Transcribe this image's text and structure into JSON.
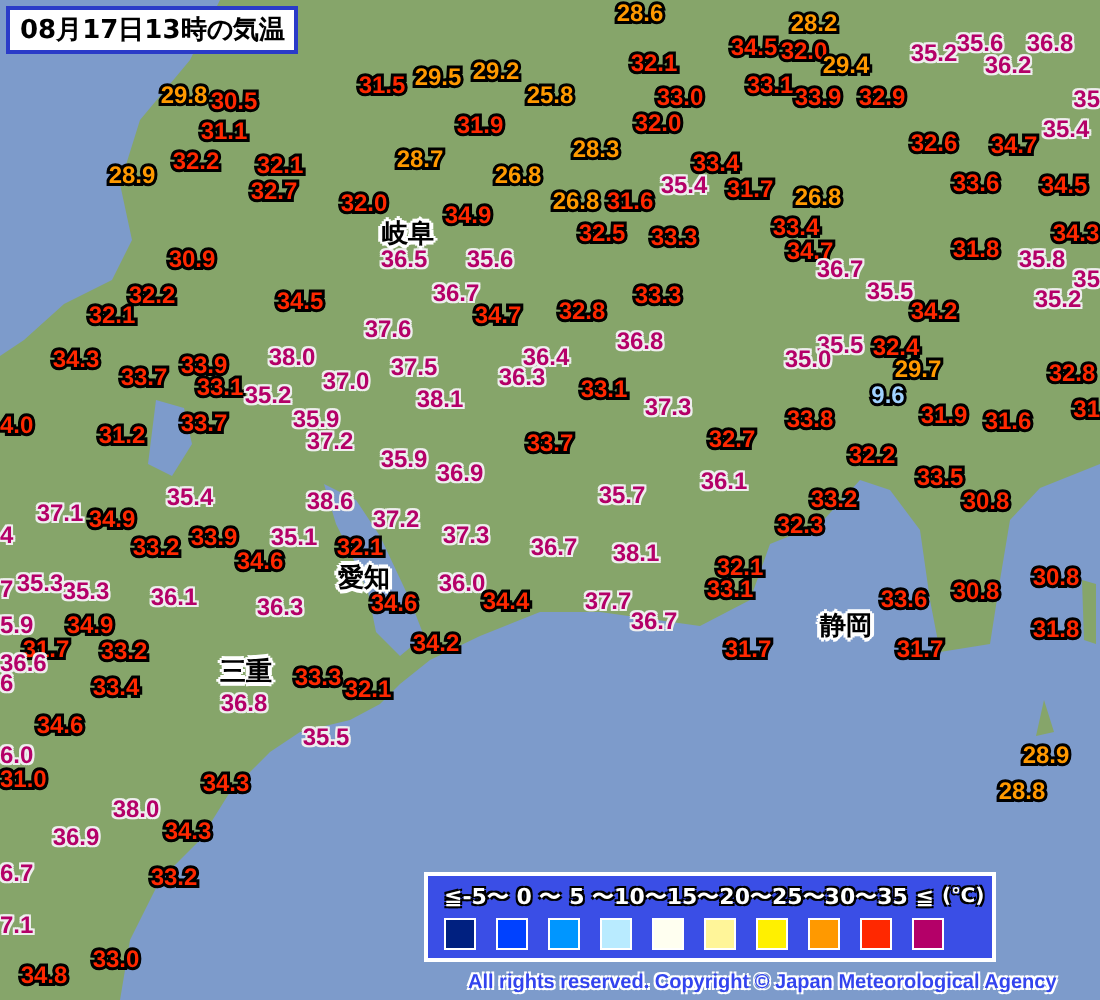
{
  "title": "08月17日13時の気温",
  "readings": [
    {
      "value": "28.6",
      "color": "#ff9900"
    },
    {
      "value": "28.2",
      "color": "#ff9900"
    },
    {
      "value": "34.5",
      "color": "#ff2800"
    },
    {
      "value": "32.0",
      "color": "#ff2800"
    },
    {
      "value": "35.2",
      "color": "#b40068"
    },
    {
      "value": "35.6",
      "color": "#b40068"
    },
    {
      "value": "36.8",
      "color": "#b40068"
    },
    {
      "value": "29.5",
      "color": "#ff9900"
    },
    {
      "value": "29.2",
      "color": "#ff9900"
    },
    {
      "value": "32.1",
      "color": "#ff2800"
    },
    {
      "value": "29.4",
      "color": "#ff9900"
    },
    {
      "value": "36.2",
      "color": "#b40068"
    },
    {
      "value": "29.8",
      "color": "#ff9900"
    },
    {
      "value": "30.5",
      "color": "#ff2800"
    },
    {
      "value": "31.5",
      "color": "#ff2800"
    },
    {
      "value": "25.8",
      "color": "#ff9900"
    },
    {
      "value": "33.0",
      "color": "#ff2800"
    },
    {
      "value": "33.1",
      "color": "#ff2800"
    },
    {
      "value": "33.9",
      "color": "#ff2800"
    },
    {
      "value": "32.9",
      "color": "#ff2800"
    },
    {
      "value": "35",
      "color": "#b40068"
    },
    {
      "value": "31.1",
      "color": "#ff2800"
    },
    {
      "value": "31.9",
      "color": "#ff2800"
    },
    {
      "value": "32.0",
      "color": "#ff2800"
    },
    {
      "value": "35.4",
      "color": "#b40068"
    },
    {
      "value": "32.2",
      "color": "#ff2800"
    },
    {
      "value": "32.1",
      "color": "#ff2800"
    },
    {
      "value": "28.7",
      "color": "#ff9900"
    },
    {
      "value": "28.3",
      "color": "#ff9900"
    },
    {
      "value": "33.4",
      "color": "#ff2800"
    },
    {
      "value": "32.6",
      "color": "#ff2800"
    },
    {
      "value": "34.7",
      "color": "#ff2800"
    },
    {
      "value": "28.9",
      "color": "#ff9900"
    },
    {
      "value": "32.7",
      "color": "#ff2800"
    },
    {
      "value": "32.0",
      "color": "#ff2800"
    },
    {
      "value": "26.8",
      "color": "#ff9900"
    },
    {
      "value": "26.8",
      "color": "#ff9900"
    },
    {
      "value": "31.6",
      "color": "#ff2800"
    },
    {
      "value": "35.4",
      "color": "#b40068"
    },
    {
      "value": "31.7",
      "color": "#ff2800"
    },
    {
      "value": "26.8",
      "color": "#ff9900"
    },
    {
      "value": "33.6",
      "color": "#ff2800"
    },
    {
      "value": "34.5",
      "color": "#ff2800"
    },
    {
      "value": "34.9",
      "color": "#ff2800"
    },
    {
      "value": "32.5",
      "color": "#ff2800"
    },
    {
      "value": "33.3",
      "color": "#ff2800"
    },
    {
      "value": "33.4",
      "color": "#ff2800"
    },
    {
      "value": "34.3",
      "color": "#ff2800"
    },
    {
      "value": "30.9",
      "color": "#ff2800"
    },
    {
      "value": "36.5",
      "color": "#b40068"
    },
    {
      "value": "35.6",
      "color": "#b40068"
    },
    {
      "value": "34.7",
      "color": "#ff2800"
    },
    {
      "value": "36.7",
      "color": "#b40068"
    },
    {
      "value": "31.8",
      "color": "#ff2800"
    },
    {
      "value": "35.8",
      "color": "#b40068"
    },
    {
      "value": "32.2",
      "color": "#ff2800"
    },
    {
      "value": "32.1",
      "color": "#ff2800"
    },
    {
      "value": "34.5",
      "color": "#ff2800"
    },
    {
      "value": "36.7",
      "color": "#b40068"
    },
    {
      "value": "34.7",
      "color": "#ff2800"
    },
    {
      "value": "32.8",
      "color": "#ff2800"
    },
    {
      "value": "33.3",
      "color": "#ff2800"
    },
    {
      "value": "35.5",
      "color": "#b40068"
    },
    {
      "value": "34.2",
      "color": "#ff2800"
    },
    {
      "value": "35",
      "color": "#b40068"
    },
    {
      "value": "35.2",
      "color": "#b40068"
    },
    {
      "value": "37.6",
      "color": "#b40068"
    },
    {
      "value": "36.8",
      "color": "#b40068"
    },
    {
      "value": "35.5",
      "color": "#b40068"
    },
    {
      "value": "32.4",
      "color": "#ff2800"
    },
    {
      "value": "34.3",
      "color": "#ff2800"
    },
    {
      "value": "33.7",
      "color": "#ff2800"
    },
    {
      "value": "33.9",
      "color": "#ff2800"
    },
    {
      "value": "38.0",
      "color": "#b40068"
    },
    {
      "value": "37.0",
      "color": "#b40068"
    },
    {
      "value": "37.5",
      "color": "#b40068"
    },
    {
      "value": "36.4",
      "color": "#b40068"
    },
    {
      "value": "36.3",
      "color": "#b40068"
    },
    {
      "value": "35.0",
      "color": "#b40068"
    },
    {
      "value": "29.7",
      "color": "#ff9900"
    },
    {
      "value": "32.8",
      "color": "#ff2800"
    },
    {
      "value": "4.0",
      "color": "#ff2800"
    },
    {
      "value": "33.1",
      "color": "#ff2800"
    },
    {
      "value": "33.7",
      "color": "#ff2800"
    },
    {
      "value": "35.2",
      "color": "#b40068"
    },
    {
      "value": "35.9",
      "color": "#b40068"
    },
    {
      "value": "38.1",
      "color": "#b40068"
    },
    {
      "value": "33.1",
      "color": "#ff2800"
    },
    {
      "value": "37.3",
      "color": "#b40068"
    },
    {
      "value": "33.8",
      "color": "#ff2800"
    },
    {
      "value": "9.6",
      "color": "#a0d2ff"
    },
    {
      "value": "31.9",
      "color": "#ff2800"
    },
    {
      "value": "31.6",
      "color": "#ff2800"
    },
    {
      "value": "31",
      "color": "#ff2800"
    },
    {
      "value": "31.2",
      "color": "#ff2800"
    },
    {
      "value": "37.2",
      "color": "#b40068"
    },
    {
      "value": "35.9",
      "color": "#b40068"
    },
    {
      "value": "36.9",
      "color": "#b40068"
    },
    {
      "value": "33.7",
      "color": "#ff2800"
    },
    {
      "value": "32.7",
      "color": "#ff2800"
    },
    {
      "value": "36.1",
      "color": "#b40068"
    },
    {
      "value": "32.2",
      "color": "#ff2800"
    },
    {
      "value": "33.5",
      "color": "#ff2800"
    },
    {
      "value": "35.4",
      "color": "#b40068"
    },
    {
      "value": "38.6",
      "color": "#b40068"
    },
    {
      "value": "35.7",
      "color": "#b40068"
    },
    {
      "value": "33.2",
      "color": "#ff2800"
    },
    {
      "value": "30.8",
      "color": "#ff2800"
    },
    {
      "value": "4",
      "color": "#b40068"
    },
    {
      "value": "37.1",
      "color": "#b40068"
    },
    {
      "value": "34.9",
      "color": "#ff2800"
    },
    {
      "value": "33.2",
      "color": "#ff2800"
    },
    {
      "value": "33.9",
      "color": "#ff2800"
    },
    {
      "value": "35.1",
      "color": "#b40068"
    },
    {
      "value": "37.2",
      "color": "#b40068"
    },
    {
      "value": "32.1",
      "color": "#ff2800"
    },
    {
      "value": "37.3",
      "color": "#b40068"
    },
    {
      "value": "36.7",
      "color": "#b40068"
    },
    {
      "value": "38.1",
      "color": "#b40068"
    },
    {
      "value": "32.3",
      "color": "#ff2800"
    },
    {
      "value": "7",
      "color": "#b40068"
    },
    {
      "value": "35.3",
      "color": "#b40068"
    },
    {
      "value": "35.3",
      "color": "#b40068"
    },
    {
      "value": "36.1",
      "color": "#b40068"
    },
    {
      "value": "34.6",
      "color": "#ff2800"
    },
    {
      "value": "36.3",
      "color": "#b40068"
    },
    {
      "value": "34.6",
      "color": "#ff2800"
    },
    {
      "value": "36.0",
      "color": "#b40068"
    },
    {
      "value": "34.4",
      "color": "#ff2800"
    },
    {
      "value": "37.7",
      "color": "#b40068"
    },
    {
      "value": "32.1",
      "color": "#ff2800"
    },
    {
      "value": "33.1",
      "color": "#ff2800"
    },
    {
      "value": "33.6",
      "color": "#ff2800"
    },
    {
      "value": "30.8",
      "color": "#ff2800"
    },
    {
      "value": "30.8",
      "color": "#ff2800"
    },
    {
      "value": "5.9",
      "color": "#b40068"
    },
    {
      "value": "34.9",
      "color": "#ff2800"
    },
    {
      "value": "31.7",
      "color": "#ff2800"
    },
    {
      "value": "33.2",
      "color": "#ff2800"
    },
    {
      "value": "34.2",
      "color": "#ff2800"
    },
    {
      "value": "36.7",
      "color": "#b40068"
    },
    {
      "value": "31.7",
      "color": "#ff2800"
    },
    {
      "value": "31.7",
      "color": "#ff2800"
    },
    {
      "value": "31.8",
      "color": "#ff2800"
    },
    {
      "value": "36.6",
      "color": "#b40068"
    },
    {
      "value": "6",
      "color": "#b40068"
    },
    {
      "value": "33.4",
      "color": "#ff2800"
    },
    {
      "value": "36.8",
      "color": "#b40068"
    },
    {
      "value": "33.3",
      "color": "#ff2800"
    },
    {
      "value": "32.1",
      "color": "#ff2800"
    },
    {
      "value": "6.0",
      "color": "#b40068"
    },
    {
      "value": "34.6",
      "color": "#ff2800"
    },
    {
      "value": "35.5",
      "color": "#b40068"
    },
    {
      "value": "28.9",
      "color": "#ff9900"
    },
    {
      "value": "31.0",
      "color": "#ff2800"
    },
    {
      "value": "34.3",
      "color": "#ff2800"
    },
    {
      "value": "28.8",
      "color": "#ff9900"
    },
    {
      "value": "38.0",
      "color": "#b40068"
    },
    {
      "value": "36.9",
      "color": "#b40068"
    },
    {
      "value": "34.3",
      "color": "#ff2800"
    },
    {
      "value": "6.7",
      "color": "#b40068"
    },
    {
      "value": "33.2",
      "color": "#ff2800"
    },
    {
      "value": "7.1",
      "color": "#b40068"
    },
    {
      "value": "33.0",
      "color": "#ff2800"
    },
    {
      "value": "34.8",
      "color": "#ff2800"
    }
  ],
  "places": [
    {
      "name": "岐阜"
    },
    {
      "name": "愛知"
    },
    {
      "name": "三重"
    },
    {
      "name": "静岡"
    }
  ],
  "legend": {
    "scale": "≦-5〜 0 〜 5 〜10〜15〜20〜25〜30〜35 ≦",
    "unit": "(℃)",
    "swatches": [
      {
        "color": "#002080"
      },
      {
        "color": "#0041ff"
      },
      {
        "color": "#0096ff"
      },
      {
        "color": "#b9ebff"
      },
      {
        "color": "#fffff0"
      },
      {
        "color": "#fff599"
      },
      {
        "color": "#fff000"
      },
      {
        "color": "#ff9900"
      },
      {
        "color": "#ff2800"
      },
      {
        "color": "#b40068"
      }
    ]
  },
  "copyright": "All rights reserved. Copyright © Japan Meteorological Agency"
}
